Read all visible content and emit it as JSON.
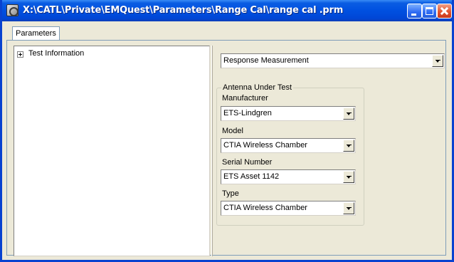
{
  "window": {
    "title": "X:\\CATL\\Private\\EMQuest\\Parameters\\Range Cal\\range cal .prm"
  },
  "tabs": [
    {
      "label": "Parameters"
    }
  ],
  "tree": {
    "items": [
      {
        "label": "Test Information",
        "expander": "+"
      }
    ]
  },
  "mode_select": {
    "value": "Response Measurement"
  },
  "antenna_group": {
    "title": "Antenna Under Test",
    "fields": [
      {
        "label": "Manufacturer",
        "value": "ETS-Lindgren"
      },
      {
        "label": "Model",
        "value": "CTIA Wireless Chamber"
      },
      {
        "label": "Serial Number",
        "value": "ETS Asset 1142"
      },
      {
        "label": "Type",
        "value": "CTIA Wireless Chamber"
      }
    ]
  },
  "colors": {
    "titlebar": "#0050e0",
    "window_face": "#ece9d8",
    "close_button": "#e2542e"
  },
  "icons": {
    "app": "app-icon",
    "minimize": "minimize-icon",
    "maximize": "maximize-icon",
    "close": "close-icon",
    "tree_expand": "plus-box-icon",
    "dropdown": "chevron-down-icon"
  }
}
